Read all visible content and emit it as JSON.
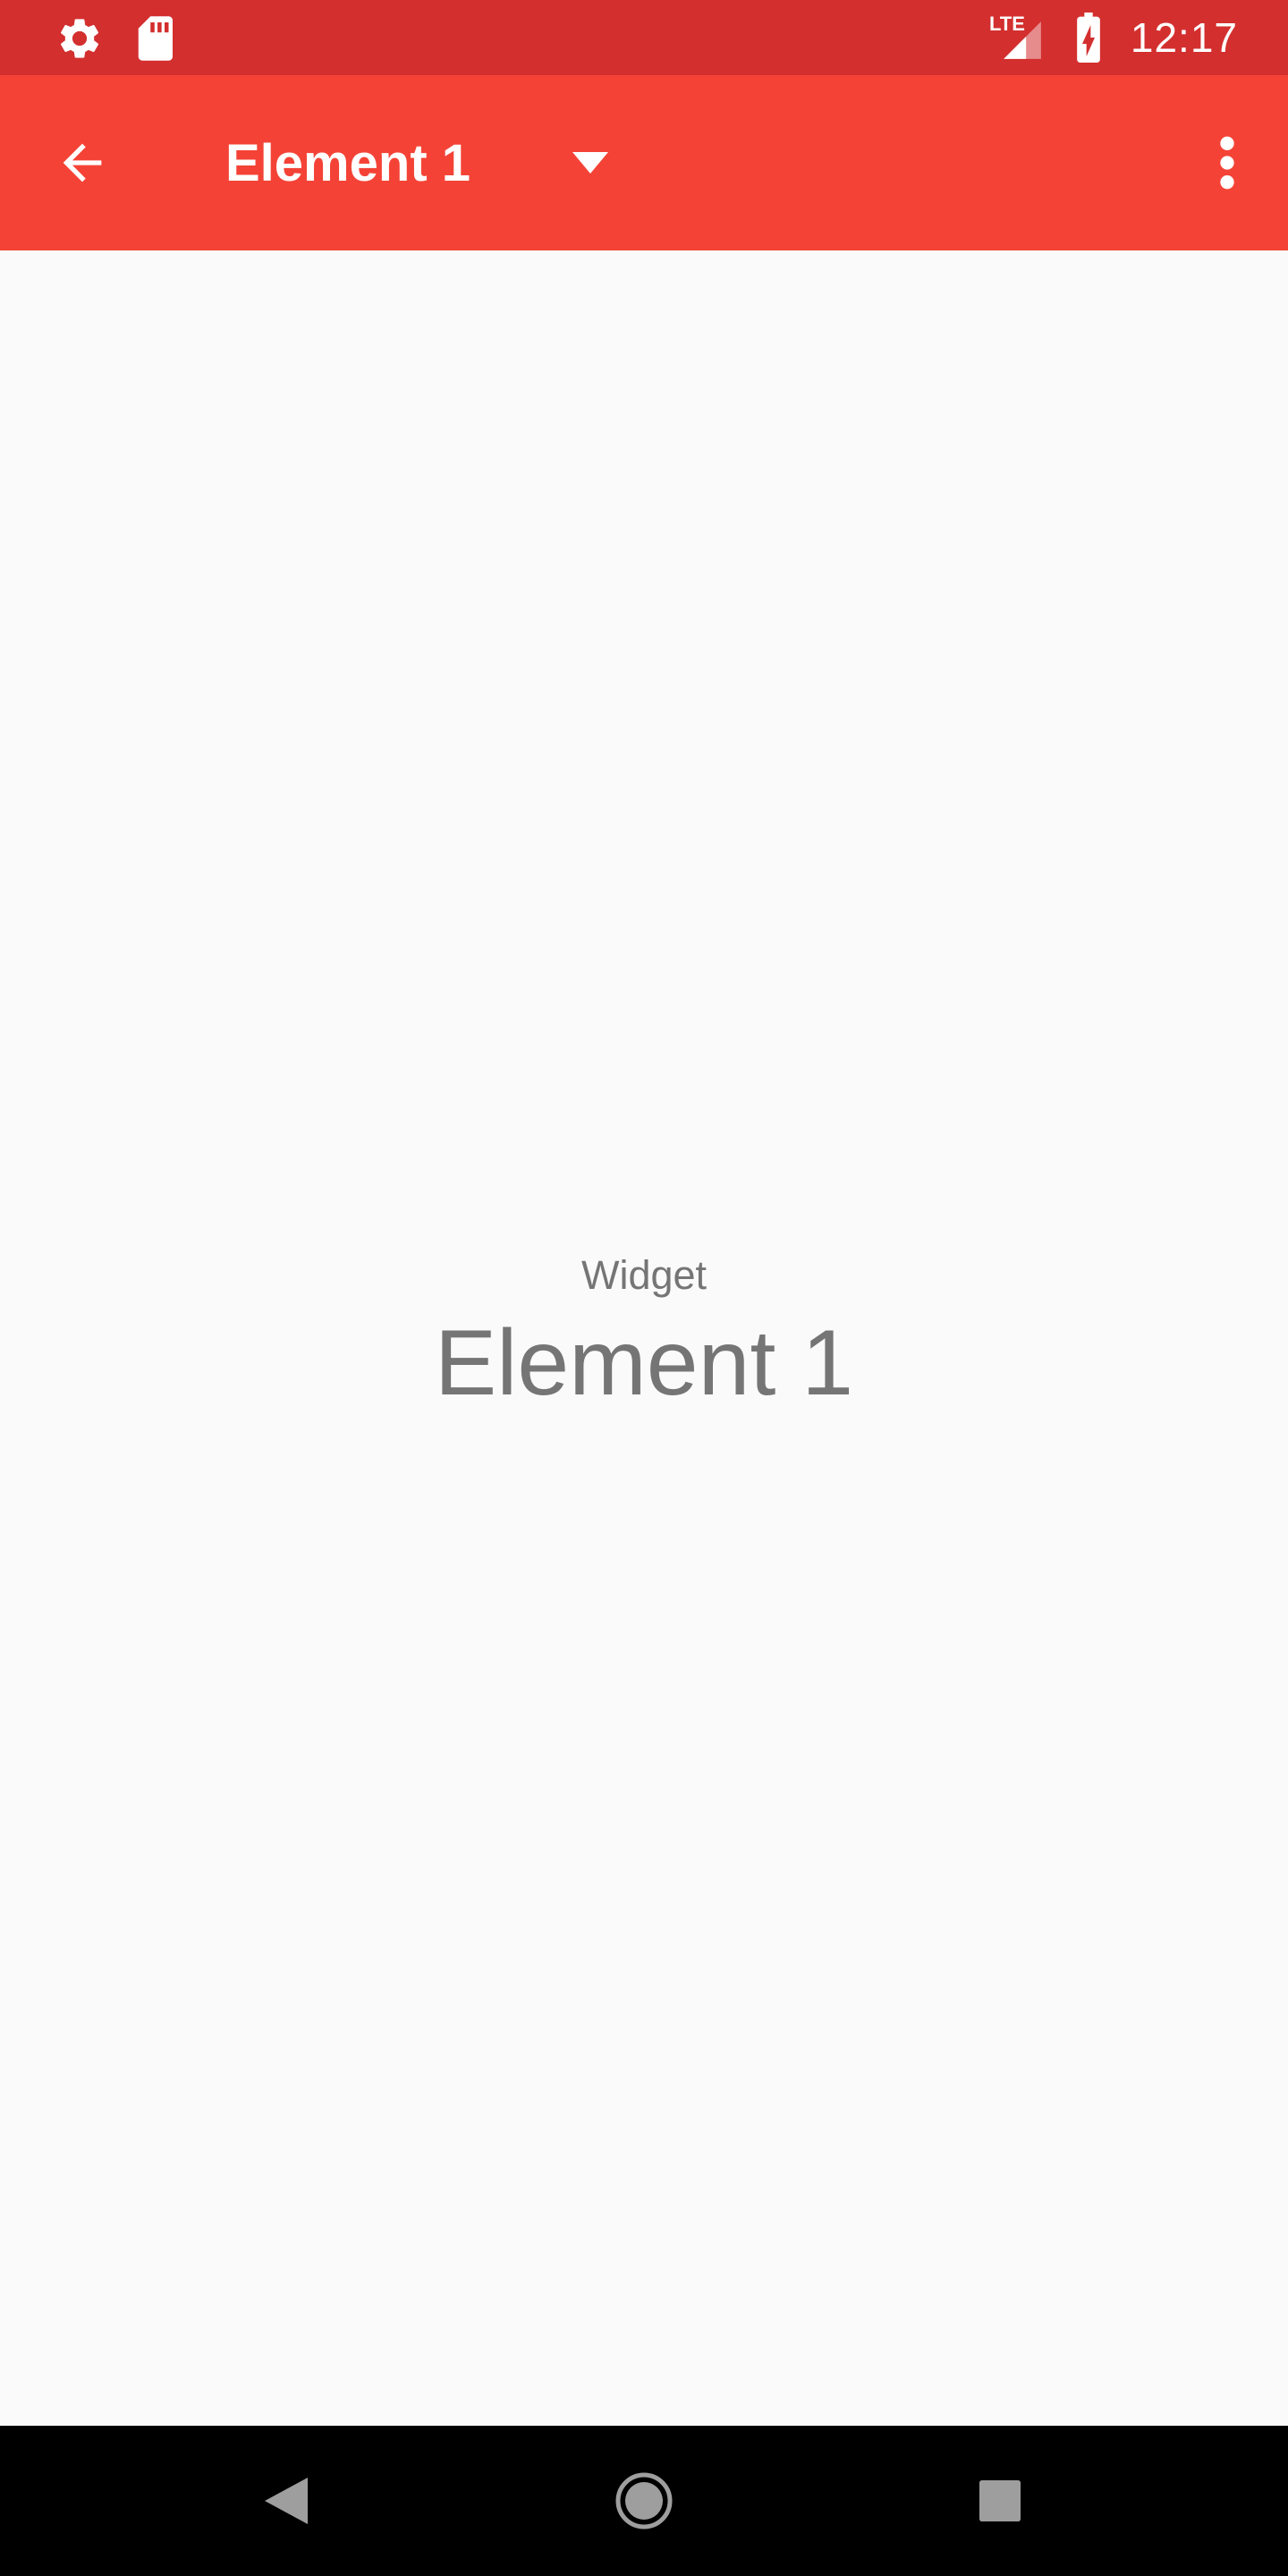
{
  "status_bar": {
    "time": "12:17",
    "network": "LTE",
    "icons": [
      "settings-icon",
      "sd-card-icon",
      "lte-signal-icon",
      "battery-charging-icon"
    ],
    "background": "#d32f2f"
  },
  "app_bar": {
    "title": "Element 1",
    "background": "#f44336",
    "icons": [
      "back-arrow-icon",
      "dropdown-caret-icon",
      "overflow-menu-icon"
    ]
  },
  "content": {
    "label": "Widget",
    "title": "Element 1",
    "text_color": "#757575"
  },
  "nav_bar": {
    "buttons": [
      "back-nav-icon",
      "home-nav-icon",
      "recents-nav-icon"
    ]
  }
}
